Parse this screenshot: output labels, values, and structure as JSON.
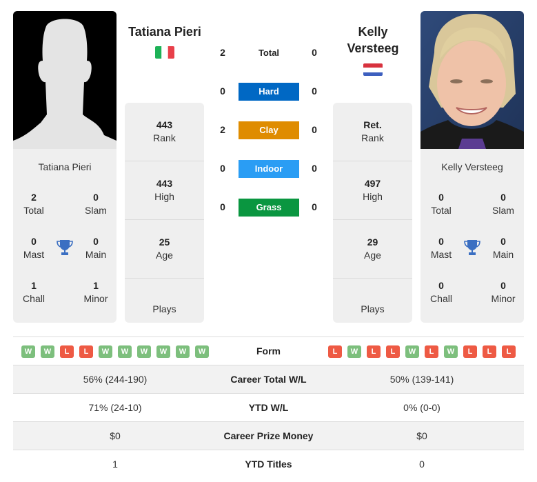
{
  "colors": {
    "hard": "#0068c4",
    "clay": "#df8c00",
    "indoor": "#2a9df4",
    "grass": "#0a9640",
    "win": "#7dbf7d",
    "loss": "#ee5a44",
    "trophy": "#3b6fc2"
  },
  "player1": {
    "name": "Tatiana Pieri",
    "card_name": "Tatiana Pieri",
    "country_flag": "italy-flag",
    "photo": "silhouette-placeholder",
    "titles": {
      "total": {
        "value": "2",
        "label": "Total"
      },
      "slam": {
        "value": "0",
        "label": "Slam"
      },
      "mast": {
        "value": "0",
        "label": "Mast"
      },
      "main": {
        "value": "0",
        "label": "Main"
      },
      "chall": {
        "value": "1",
        "label": "Chall"
      },
      "minor": {
        "value": "1",
        "label": "Minor"
      }
    },
    "stats": {
      "rank": {
        "value": "443",
        "label": "Rank"
      },
      "high": {
        "value": "443",
        "label": "High"
      },
      "age": {
        "value": "25",
        "label": "Age"
      },
      "plays": {
        "value": "",
        "label": "Plays"
      }
    }
  },
  "player2": {
    "name": "Kelly Versteeg",
    "name_line1": "Kelly",
    "name_line2": "Versteeg",
    "card_name": "Kelly Versteeg",
    "country_flag": "netherlands-flag",
    "photo": "player-photo",
    "titles": {
      "total": {
        "value": "0",
        "label": "Total"
      },
      "slam": {
        "value": "0",
        "label": "Slam"
      },
      "mast": {
        "value": "0",
        "label": "Mast"
      },
      "main": {
        "value": "0",
        "label": "Main"
      },
      "chall": {
        "value": "0",
        "label": "Chall"
      },
      "minor": {
        "value": "0",
        "label": "Minor"
      }
    },
    "stats": {
      "rank": {
        "value": "Ret.",
        "label": "Rank"
      },
      "high": {
        "value": "497",
        "label": "High"
      },
      "age": {
        "value": "29",
        "label": "Age"
      },
      "plays": {
        "value": "",
        "label": "Plays"
      }
    }
  },
  "h2h": [
    {
      "label": "Total",
      "p1": "2",
      "p2": "0",
      "surface": "total"
    },
    {
      "label": "Hard",
      "p1": "0",
      "p2": "0",
      "surface": "hard"
    },
    {
      "label": "Clay",
      "p1": "2",
      "p2": "0",
      "surface": "clay"
    },
    {
      "label": "Indoor",
      "p1": "0",
      "p2": "0",
      "surface": "indoor"
    },
    {
      "label": "Grass",
      "p1": "0",
      "p2": "0",
      "surface": "grass"
    }
  ],
  "comparison": {
    "form_label": "Form",
    "p1_form": [
      "W",
      "W",
      "L",
      "L",
      "W",
      "W",
      "W",
      "W",
      "W",
      "W"
    ],
    "p2_form": [
      "L",
      "W",
      "L",
      "L",
      "W",
      "L",
      "W",
      "L",
      "L",
      "L"
    ],
    "rows": [
      {
        "label": "Career Total W/L",
        "p1": "56% (244-190)",
        "p2": "50% (139-141)"
      },
      {
        "label": "YTD W/L",
        "p1": "71% (24-10)",
        "p2": "0% (0-0)"
      },
      {
        "label": "Career Prize Money",
        "p1": "$0",
        "p2": "$0"
      },
      {
        "label": "YTD Titles",
        "p1": "1",
        "p2": "0"
      }
    ]
  }
}
